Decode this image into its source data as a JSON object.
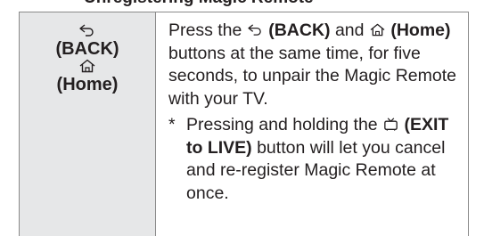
{
  "clipped_heading": "Unregistering Magic Remote",
  "left_column": {
    "back_label": "(BACK)",
    "home_label": "(Home)"
  },
  "instruction": {
    "part1": "Press the ",
    "back": "(BACK)",
    "part2": " and ",
    "home": "(Home)",
    "part3": " buttons at the same time, for five seconds, to unpair the Magic Remote with your TV."
  },
  "note": {
    "bullet": "*",
    "part1": "Pressing and holding the ",
    "exit": "(EXIT to LIVE)",
    "part2": " button will let you cancel and re-register Magic Remote at once."
  },
  "icons": {
    "back": "back-arrow-icon",
    "home": "home-icon",
    "exit": "exit-to-live-tv-icon"
  }
}
